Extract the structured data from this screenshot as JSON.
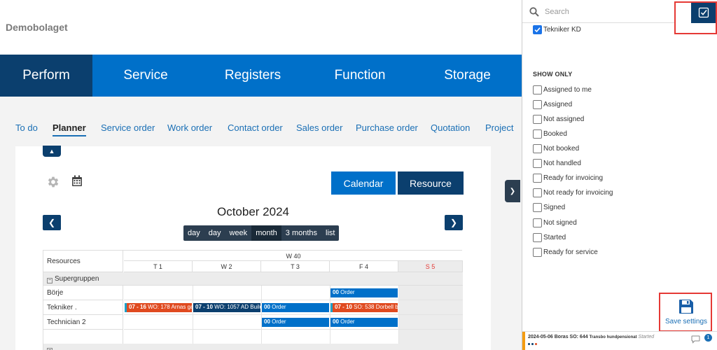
{
  "header": {
    "brand": "Demobolaget"
  },
  "main_nav": [
    {
      "label": "Perform",
      "active": true
    },
    {
      "label": "Service",
      "active": false
    },
    {
      "label": "Registers",
      "active": false
    },
    {
      "label": "Function",
      "active": false
    },
    {
      "label": "Storage",
      "active": false
    }
  ],
  "sub_nav": [
    {
      "label": "To do"
    },
    {
      "label": "Planner",
      "active": true
    },
    {
      "label": "Service order"
    },
    {
      "label": "Work order"
    },
    {
      "label": "Contact order"
    },
    {
      "label": "Sales order"
    },
    {
      "label": "Purchase order"
    },
    {
      "label": "Quotation"
    },
    {
      "label": "Project"
    }
  ],
  "planner": {
    "view_calendar": "Calendar",
    "view_resource": "Resource",
    "month_title": "October 2024",
    "ranges": [
      {
        "label": "day"
      },
      {
        "label": "day"
      },
      {
        "label": "week"
      },
      {
        "label": "month",
        "active": true
      },
      {
        "label": "3 months"
      },
      {
        "label": "list"
      }
    ],
    "grid": {
      "resources_header": "Resources",
      "week_label": "W 40",
      "days": [
        {
          "label": "T 1",
          "weekend": false
        },
        {
          "label": "W 2",
          "weekend": false
        },
        {
          "label": "T 3",
          "weekend": false
        },
        {
          "label": "F 4",
          "weekend": false
        },
        {
          "label": "S 5",
          "weekend": true
        }
      ],
      "group": "Supergruppen",
      "resources": [
        "Börje",
        "Tekniker .",
        "Technician 2"
      ],
      "events": [
        {
          "row": 0,
          "day": 3,
          "span": 1,
          "time": "00",
          "text": "Order",
          "color": "blue"
        },
        {
          "row": 1,
          "day": 0,
          "span": 1,
          "time": "07 - 16",
          "text": "WO: 178 Arnas gar",
          "color": "red"
        },
        {
          "row": 1,
          "day": 1,
          "span": 1,
          "time": "07 - 10",
          "text": "WO: 1057 AD Build",
          "color": "navy"
        },
        {
          "row": 1,
          "day": 2,
          "span": 1,
          "time": "00",
          "text": "Order",
          "color": "blue"
        },
        {
          "row": 1,
          "day": 3,
          "span": 1,
          "time": "07 - 10",
          "text": "SO: 538 Dorbell by",
          "color": "red"
        },
        {
          "row": 2,
          "day": 2,
          "span": 1,
          "time": "00",
          "text": "Order",
          "color": "blue"
        },
        {
          "row": 2,
          "day": 3,
          "span": 1,
          "time": "00",
          "text": "Order",
          "color": "blue"
        }
      ]
    }
  },
  "panel": {
    "search_placeholder": "Search",
    "tekniker_label": "Tekniker KD",
    "show_only_title": "SHOW ONLY",
    "filters": [
      "Assigned to me",
      "Assigned",
      "Not assigned",
      "Booked",
      "Not booked",
      "Not handled",
      "Ready for invoicing",
      "Not ready for invoicing",
      "Signed",
      "Not signed",
      "Started",
      "Ready for service"
    ],
    "save_label": "Save settings",
    "bottom_item": {
      "date_place": "2024-05-06 Boras",
      "so": "SO: 644",
      "customer": "Transbo hundpensionat",
      "status": "Started",
      "count": "1"
    }
  },
  "colors": {
    "nav_blue": "#0070c9",
    "nav_dark": "#0b3f6e",
    "highlight_red": "#e53935"
  }
}
